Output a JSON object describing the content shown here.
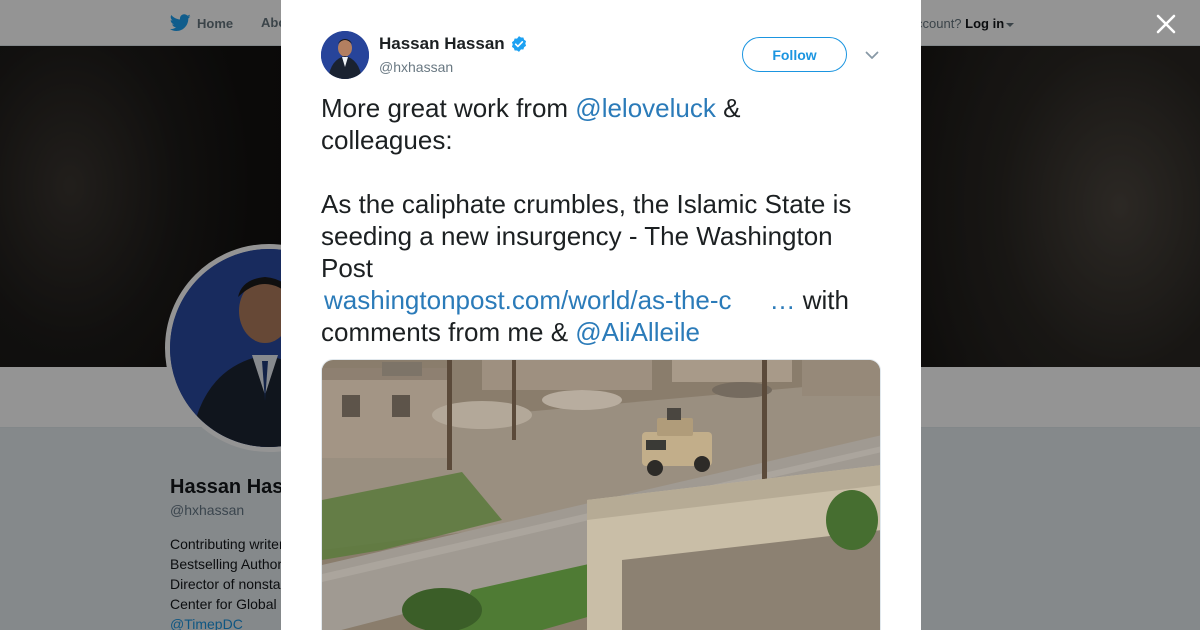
{
  "background_page": {
    "nav": {
      "home_label": "Home",
      "about_label_partial": "Abo",
      "account_prompt_partial": "ccount?",
      "login_label": "Log in"
    },
    "profile": {
      "name_partial": "Hassan Has",
      "handle": "@hxhassan",
      "bio_lines": [
        "Contributing writer",
        "Bestselling Author",
        "Director of nonsta",
        "Center for Global"
      ],
      "bio_link": "@TimepDC"
    }
  },
  "tweet": {
    "author": {
      "name": "Hassan Hassan",
      "handle": "@hxhassan",
      "verified": true
    },
    "follow_label": "Follow",
    "text": {
      "line1_pre": "More great work from ",
      "mention1": "@leloveluck",
      "line1_post": " &",
      "line2": "colleagues:",
      "para2": "As the caliphate crumbles, the Islamic State is seeding a new insurgency - The Washington Post",
      "url": "washingtonpost.com/world/as-the-c",
      "ellipsis": "…",
      "after_url": " with",
      "line_last_pre": "comments from me & ",
      "mention2": "@AliAlleile"
    },
    "photo_icon": "armored-vehicle-street-photo"
  },
  "colors": {
    "link": "#2b7bb9",
    "follow_border": "#1b95e0",
    "verified_badge": "#1da1f2",
    "twitter_bird": "#1da1f2",
    "overlay": "rgba(0,0,0,0.42)"
  }
}
